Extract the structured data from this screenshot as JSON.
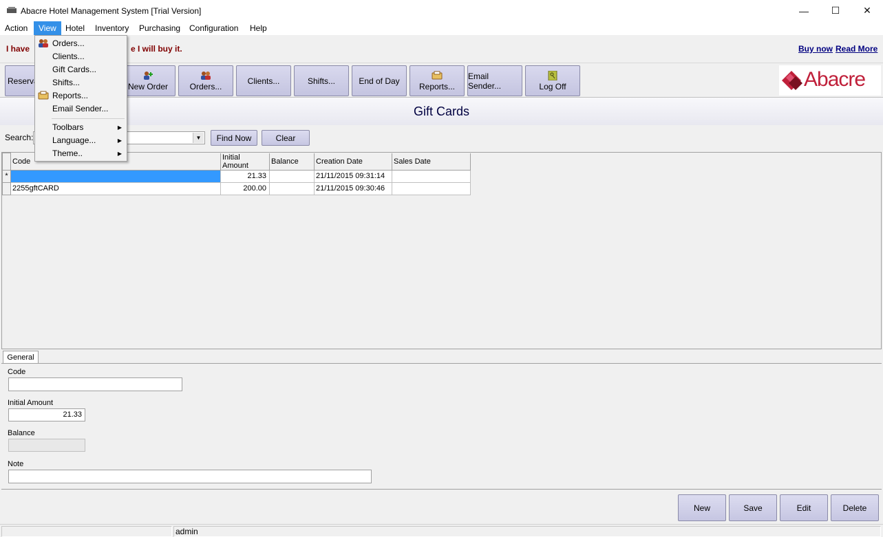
{
  "window": {
    "title": "Abacre Hotel Management System [Trial Version]",
    "minimize_glyph": "—",
    "maximize_glyph": "☐",
    "close_glyph": "✕"
  },
  "menubar": {
    "items": [
      "Action",
      "View",
      "Hotel",
      "Inventory",
      "Purchasing",
      "Configuration",
      "Help"
    ],
    "active": "View"
  },
  "nag": {
    "text": "I have",
    "text_tail": "e I will buy it.",
    "buy_now": "Buy now",
    "read_more": "Read More"
  },
  "toolbar": {
    "buttons": [
      "Reserva",
      "New Order",
      "Orders...",
      "Clients...",
      "Shifts...",
      "End of Day",
      "Reports...",
      "Email Sender...",
      "Log Off"
    ],
    "logo_text": "Abacre"
  },
  "page": {
    "title": "Gift Cards"
  },
  "search": {
    "label": "Search:",
    "value": "",
    "find_now": "Find Now",
    "clear": "Clear"
  },
  "grid": {
    "columns": [
      "Code",
      "Initial Amount",
      "Balance",
      "Creation Date",
      "Sales Date"
    ],
    "rows": [
      {
        "marker": "*",
        "code": "",
        "initial_amount": "21.33",
        "balance": "",
        "creation_date": "21/11/2015 09:31:14",
        "sales_date": ""
      },
      {
        "marker": "",
        "code": "2255gftCARD",
        "initial_amount": "200.00",
        "balance": "",
        "creation_date": "21/11/2015 09:30:46",
        "sales_date": ""
      }
    ]
  },
  "detail": {
    "tab": "General",
    "code_label": "Code",
    "code_value": "",
    "initial_amount_label": "Initial Amount",
    "initial_amount_value": "21.33",
    "balance_label": "Balance",
    "balance_value": "",
    "note_label": "Note",
    "note_value": ""
  },
  "actions": {
    "new": "New",
    "save": "Save",
    "edit": "Edit",
    "delete": "Delete"
  },
  "status": {
    "user": "admin"
  },
  "view_menu": {
    "items": [
      {
        "label": "Orders...",
        "icon": "people-icon"
      },
      {
        "label": "Clients...",
        "icon": ""
      },
      {
        "label": "Gift Cards...",
        "icon": ""
      },
      {
        "label": "Shifts...",
        "icon": ""
      },
      {
        "label": "Reports...",
        "icon": "reports-icon"
      },
      {
        "label": "Email Sender...",
        "icon": ""
      },
      {
        "label": "Toolbars",
        "submenu": true
      },
      {
        "label": "Language...",
        "submenu": true
      },
      {
        "label": "Theme..",
        "submenu": true
      }
    ]
  },
  "colors": {
    "accent": "#3390e8",
    "nag_text": "#800000",
    "link": "#000080",
    "selected_row": "#3399ff",
    "button": "#c6c6e2"
  }
}
